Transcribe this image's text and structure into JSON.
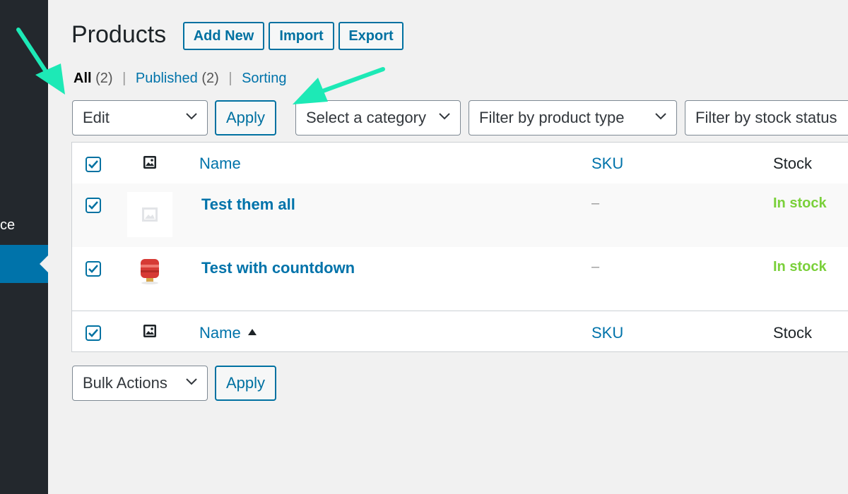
{
  "sidebar": {
    "label_fragment": "ce"
  },
  "header": {
    "title": "Products",
    "buttons": [
      "Add New",
      "Import",
      "Export"
    ]
  },
  "views": {
    "all": "All",
    "all_count": "(2)",
    "published": "Published",
    "published_count": "(2)",
    "sorting": "Sorting",
    "separator": "|"
  },
  "top_actions": {
    "bulk_select": "Edit",
    "apply": "Apply",
    "category_filter": "Select a category",
    "product_type_filter": "Filter by product type",
    "stock_status_filter": "Filter by stock status"
  },
  "table": {
    "columns": {
      "name": "Name",
      "sku": "SKU",
      "stock": "Stock"
    },
    "rows": [
      {
        "name": "Test them all",
        "sku": "–",
        "stock": "In stock",
        "checked": true
      },
      {
        "name": "Test with countdown",
        "sku": "–",
        "stock": "In stock",
        "checked": true
      }
    ]
  },
  "bottom_actions": {
    "bulk_select": "Bulk Actions",
    "apply": "Apply"
  },
  "colors": {
    "accent": "#0071a1",
    "link": "#0073aa",
    "in_stock": "#7ad03a",
    "sidebar_bg": "#23282d",
    "annotation_arrow": "#1de9b6"
  }
}
